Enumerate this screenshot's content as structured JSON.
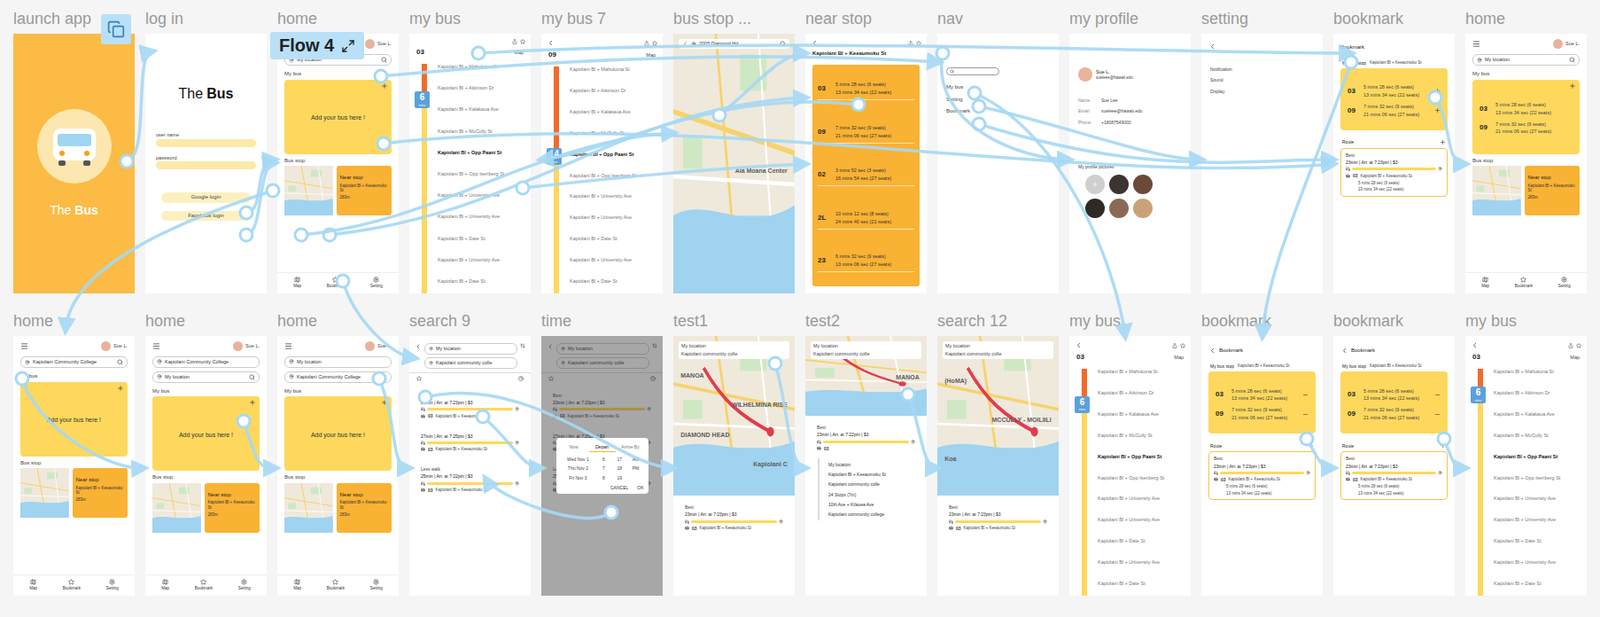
{
  "canvas": {
    "flow": "Flow 4"
  },
  "frames": [
    {
      "label": "launch app",
      "kind": "splash",
      "titleLight": "The",
      "titleStrong": "Bus"
    },
    {
      "label": "log in",
      "kind": "login",
      "titleLight": "The",
      "titleStrong": "Bus",
      "fields": [
        "user name",
        "password"
      ],
      "buttons": [
        "Google login",
        "Facebook login"
      ]
    },
    {
      "label": "home",
      "kind": "home",
      "user": "Sue L.",
      "searches": [
        "My location"
      ],
      "myBus": "My bus",
      "addBus": "Add your bus here !",
      "buses": [],
      "busStop": "Bus stop",
      "nearStop": {
        "title": "Near stop",
        "stop": "Kapiolani Bl + Keeaumoku St",
        "distance": "283m"
      },
      "nav": [
        "Map",
        "Bookmark",
        "Setting"
      ]
    },
    {
      "label": "my bus",
      "kind": "busline",
      "back": false,
      "route": "03",
      "mapLabel": "Map",
      "badge": "6",
      "badgeNote": "mins",
      "busLevel": 0.12,
      "stops": [
        {
          "name": "Kapiolani Bl + Mahukona St",
          "current": false
        },
        {
          "name": "Kapiolani Bl + Atkinson Dr",
          "current": false
        },
        {
          "name": "Kapiolani Bl + Kalakaua Ave",
          "current": false
        },
        {
          "name": "Kapiolani Bl + McCully St",
          "current": false
        },
        {
          "name": "Kapiolani Bl + Opp Paani St",
          "current": true
        },
        {
          "name": "Kapiolani Bl + Opp Isenberg St",
          "current": false
        },
        {
          "name": "Kapiolani Bl + University Ave",
          "current": false
        },
        {
          "name": "Kapiolani Bl + University Ave",
          "current": false
        },
        {
          "name": "Kapiolani Bl + Date St",
          "current": false
        },
        {
          "name": "Kapiolani Bl + University Ave",
          "current": false
        },
        {
          "name": "Kapiolani Bl + Date St",
          "current": false
        }
      ]
    },
    {
      "label": "my bus 7",
      "kind": "busline",
      "back": true,
      "route": "09",
      "mapLabel": "Map",
      "badge": "14",
      "badgeNote": "mins",
      "busLevel": 0.36,
      "stops": [
        {
          "name": "Kapiolani Bl + Mahukona St",
          "current": false
        },
        {
          "name": "Kapiolani Bl + Atkinson Dr",
          "current": false
        },
        {
          "name": "Kapiolani Bl + Kalakaua Ave",
          "current": false
        },
        {
          "name": "Kapiolani Bl + McCully St",
          "current": false
        },
        {
          "name": "Kapiolani Bl + Opp Paani St",
          "current": true
        },
        {
          "name": "Kapiolani Bl + Opp Isenberg St",
          "current": false
        },
        {
          "name": "Kapiolani Bl + University Ave",
          "current": false
        },
        {
          "name": "Kapiolani Bl + University Ave",
          "current": false
        },
        {
          "name": "Kapiolani Bl + Date St",
          "current": false
        },
        {
          "name": "Kapiolani Bl + University Ave",
          "current": false
        },
        {
          "name": "Kapiolani Bl + Date St",
          "current": false
        }
      ]
    },
    {
      "label": "bus stop ...",
      "kind": "map",
      "search": "2005 Diamond Hd",
      "places": [
        "Ala Moana Center"
      ]
    },
    {
      "label": "near stop",
      "kind": "stoptimes",
      "title": "Kapiolani Bl + Keeaumoku St",
      "routes": [
        {
          "route": "03",
          "times": [
            "5 mins 28 sec (6 seats)",
            "13 mins 34 sec (22 seats)"
          ]
        },
        {
          "route": "09",
          "times": [
            "7 mins 32 sec (9 seats)",
            "21 mins 06 sec (27 seats)"
          ]
        },
        {
          "route": "02",
          "times": [
            "3 mins 52 sec (3 seats)",
            "16 mins 54 sec (27 seats)"
          ]
        },
        {
          "route": "2L",
          "times": [
            "10 mins 12 sec (8 seats)",
            "24 mins 40 sec (21 seats)"
          ]
        },
        {
          "route": "23",
          "times": [
            "6 mins 32 sec (9 seats)",
            "13 mins 06 sec (27 seats)"
          ]
        }
      ]
    },
    {
      "label": "nav",
      "kind": "nav",
      "items": [
        "My bus",
        "Setting",
        "Bookmark"
      ]
    },
    {
      "label": "my profile",
      "kind": "profile",
      "name": "Sue L.",
      "email": "sueleee@hawaii.edu",
      "fields": [
        {
          "key": "Name",
          "value": "Sue Lee"
        },
        {
          "key": "Email",
          "value": "sueleee@hawaii.edu"
        },
        {
          "key": "Phone",
          "value": "+18087549000"
        }
      ],
      "picturesTitle": "My profile pictures",
      "pictures": [
        {
          "color": "#3b3430"
        },
        {
          "color": "#6b4a3a"
        },
        {
          "color": "#2f2a28"
        },
        {
          "color": "#8a6a55"
        },
        {
          "color": "#c9a27a"
        }
      ]
    },
    {
      "label": "setting",
      "kind": "settings",
      "items": [
        "Notification",
        "Sound",
        "Display"
      ]
    },
    {
      "label": "bookmark",
      "kind": "bookmark",
      "back": false,
      "title": "Bookmark",
      "stopTitle": "My bus stop",
      "stopName": "Kapiolani Bl + Keeaumoku St",
      "removable": false,
      "routes": [
        {
          "route": "03",
          "times": [
            "5 mins 28 sec (6 seats)",
            "13 mins 34 sec (22 seats)"
          ]
        },
        {
          "route": "09",
          "times": [
            "7 mins 32 sec (9 seats)",
            "21 mins 06 sec (27 seats)"
          ]
        }
      ],
      "routeTitle": "Route",
      "trip": {
        "label": "Best",
        "summary": "23min | Arr. at 7:23pm | $3",
        "line": "03",
        "stop": "Kapiolani Bl + Keeaumoku St",
        "times": [
          "5 mins 28 sec (6 seats)",
          "13 mins 34 sec (22 seats)"
        ]
      }
    },
    {
      "label": "home",
      "kind": "home",
      "user": "Sue L.",
      "searches": [
        "My location"
      ],
      "myBus": "My bus",
      "buses": [
        {
          "route": "03",
          "times": [
            "5 mins 28 sec (6 seats)",
            "13 mins 34 sec (22 seats)"
          ]
        },
        {
          "route": "09",
          "times": [
            "7 mins 32 sec (9 seats)",
            "21 mins 06 sec (27 seats)"
          ]
        }
      ],
      "busStop": "Bus stop",
      "nearStop": {
        "title": "Near stop",
        "stop": "Kapiolani Bl + Keeaumoku St",
        "distance": "283m"
      },
      "nav": [
        "Map",
        "Bookmark",
        "Setting"
      ]
    },
    {
      "label": "home",
      "kind": "home",
      "user": "Sue L.",
      "searches": [
        "Kapiolani Community College"
      ],
      "myBus": "My bus",
      "addBus": "Add your bus here !",
      "buses": [],
      "busStop": "Bus stop",
      "nearStop": {
        "title": "Near stop",
        "stop": "Kapiolani Bl + Keeaumoku St",
        "distance": "283m"
      },
      "nav": [
        "Map",
        "Bookmark",
        "Setting"
      ]
    },
    {
      "label": "home",
      "kind": "home",
      "user": "Sue L.",
      "searches": [
        "Kapiolani Community College",
        "My location"
      ],
      "myBus": "My bus",
      "addBus": "Add your bus here !",
      "buses": [],
      "busStop": "Bus stop",
      "nearStop": {
        "title": "Near stop",
        "stop": "Kapiolani Bl + Keeaumoku St",
        "distance": "283m"
      },
      "nav": [
        "Map",
        "Bookmark",
        "Setting"
      ]
    },
    {
      "label": "home",
      "kind": "home",
      "user": "Sue L.",
      "searches": [
        "My location",
        "Kapiolani Community College"
      ],
      "myBus": "My bus",
      "addBus": "Add your bus here !",
      "buses": [],
      "busStop": "Bus stop",
      "nearStop": {
        "title": "Near stop",
        "stop": "Kapiolani Bl + Keeaumoku St",
        "distance": "283m"
      },
      "nav": [
        "Map",
        "Bookmark",
        "Setting"
      ]
    },
    {
      "label": "search 9",
      "kind": "search",
      "from": "My location",
      "to": "Kapiolani community colle",
      "results": [
        {
          "label": "Best",
          "summary": "23min | Arr. at 7:23pm | $3",
          "line": "03",
          "stop": "Kapiolani Bl + Keeaumoku St"
        },
        {
          "summary": "27min | Arr. at 7:25pm | $3",
          "line": "03",
          "stop": "Kapiolani Bl + Keeaumoku St"
        },
        {
          "label": "Less walk",
          "summary": "25min | Arr. at 7:22pm | $3",
          "line": "03",
          "stop": "Kapiolani Bl + Keeaumoku St"
        }
      ]
    },
    {
      "label": "time",
      "kind": "time",
      "from": "My location",
      "to": "Kapiolani community colle",
      "results": [
        {
          "label": "Best",
          "summary": "23min | Arr. at 7:23pm | $3",
          "line": "03",
          "stop": "Kapiolani Bl + Keeaumoku St"
        },
        {
          "summary": "27min | Arr. at 7:25pm | $3",
          "line": "03",
          "stop": "Kapiolani Bl + Keeaumoku St"
        },
        {
          "label": "Less walk",
          "summary": "25min | Arr. at 7:22pm | $3",
          "line": "03",
          "stop": "Kapiolani Bl + Keeaumoku St"
        }
      ],
      "dialog": {
        "modes": [
          {
            "label": "Now",
            "selected": false
          },
          {
            "label": "Depart",
            "selected": true
          },
          {
            "label": "Arrive By",
            "selected": false
          }
        ],
        "days": [
          "Wed Nov 1",
          "Thu Nov 2",
          "Fri Nov 3"
        ],
        "hours": [
          "6",
          "7",
          "8"
        ],
        "minutes": [
          "17",
          "18",
          "19"
        ],
        "periods": [
          "AM",
          "PM"
        ],
        "actions": [
          "CANCEL",
          "OK"
        ]
      }
    },
    {
      "label": "test1",
      "kind": "routemap",
      "from": "My location",
      "to": "Kapiolani community colle",
      "places": [
        "MANOA",
        "WILHELMINA RISE",
        "DIAMOND HEAD",
        "Kapiolani C"
      ],
      "result": {
        "label": "Best",
        "summary": "23min | Arr. at 7:23pm | $3",
        "line": "03",
        "stop": "Kapiolani Bl + Keeaumoku St"
      }
    },
    {
      "label": "test2",
      "kind": "routedetail",
      "from": "My location",
      "to": "Kapiolani community colle",
      "places": [
        "MANOA"
      ],
      "result": {
        "label": "Best",
        "summary": "23min | Arr. at 7:22pm | $3",
        "line": "03"
      },
      "steps": [
        "My location",
        "Kapiolani Bl + Keeaumoku St",
        "Kapiolani community colle",
        "24 Stops (7m)",
        "10th Ave + Kilauea Ave",
        "Kapiolani community college"
      ]
    },
    {
      "label": "search 12",
      "kind": "routemap",
      "from": "My location",
      "to": "Kapiolani community colle",
      "places": [
        "(HoMA)",
        "MCCULLY - MOILIILI",
        "Koa"
      ],
      "result": {
        "label": "Best",
        "summary": "23min | Arr. at 7:23pm | $3",
        "line": "03",
        "stop": "Kapiolani Bl + Keeaumoku St"
      }
    },
    {
      "label": "my bus",
      "kind": "busline",
      "back": true,
      "route": "03",
      "mapLabel": "Map",
      "badge": "6",
      "badgeNote": "mins",
      "busLevel": 0.12,
      "stops": [
        {
          "name": "Kapiolani Bl + Mahukona St",
          "current": false
        },
        {
          "name": "Kapiolani Bl + Atkinson Dr",
          "current": false
        },
        {
          "name": "Kapiolani Bl + Kalakaua Ave",
          "current": false
        },
        {
          "name": "Kapiolani Bl + McCully St",
          "current": false
        },
        {
          "name": "Kapiolani Bl + Opp Paani St",
          "current": true
        },
        {
          "name": "Kapiolani Bl + Opp Isenberg St",
          "current": false
        },
        {
          "name": "Kapiolani Bl + University Ave",
          "current": false
        },
        {
          "name": "Kapiolani Bl + University Ave",
          "current": false
        },
        {
          "name": "Kapiolani Bl + Date St",
          "current": false
        },
        {
          "name": "Kapiolani Bl + University Ave",
          "current": false
        },
        {
          "name": "Kapiolani Bl + Date St",
          "current": false
        }
      ]
    },
    {
      "label": "bookmark",
      "kind": "bookmark",
      "back": true,
      "title": "Bookmark",
      "stopTitle": "My bus stop",
      "stopName": "Kapiolani Bl + Keeaumoku St",
      "removable": true,
      "routes": [
        {
          "route": "03",
          "times": [
            "5 mins 28 sec (6 seats)",
            "13 mins 34 sec (22 seats)"
          ]
        },
        {
          "route": "09",
          "times": [
            "7 mins 32 sec (9 seats)",
            "21 mins 06 sec (27 seats)"
          ]
        }
      ],
      "routeTitle": "Route",
      "trip": {
        "label": "Best",
        "summary": "23min | Arr. at 7:23pm | $3",
        "line": "03",
        "stop": "Kapiolani Bl + Keeaumoku St",
        "times": [
          "5 mins 28 sec (6 seats)",
          "13 mins 34 sec (22 seats)"
        ]
      }
    },
    {
      "label": "bookmark",
      "kind": "bookmark",
      "back": true,
      "title": "Bookmark",
      "stopTitle": "My bus stop",
      "stopName": "Kapiolani Bl + Keeaumoku St",
      "removable": true,
      "routes": [
        {
          "route": "03",
          "times": [
            "5 mins 28 sec (6 seats)",
            "13 mins 34 sec (22 seats)"
          ]
        },
        {
          "route": "09",
          "times": [
            "7 mins 32 sec (9 seats)",
            "21 mins 06 sec (27 seats)"
          ]
        }
      ],
      "routeTitle": "Route",
      "trip": {
        "label": "Best",
        "summary": "23min | Arr. at 7:23pm | $3",
        "line": "03",
        "stop": "Kapiolani Bl + Keeaumoku St",
        "times": [
          "5 mins 28 sec (6 seats)",
          "13 mins 34 sec (22 seats)"
        ]
      }
    },
    {
      "label": "my bus",
      "kind": "busline",
      "back": true,
      "route": "03",
      "mapLabel": "Map",
      "badge": "6",
      "badgeNote": "mins",
      "busLevel": 0.08,
      "stops": [
        {
          "name": "Kapiolani Bl + Mahukona St",
          "current": false
        },
        {
          "name": "Kapiolani Bl + Atkinson Dr",
          "current": false
        },
        {
          "name": "Kapiolani Bl + Kalakaua Ave",
          "current": false
        },
        {
          "name": "Kapiolani Bl + McCully St",
          "current": false
        },
        {
          "name": "Kapiolani Bl + Opp Paani St",
          "current": true
        },
        {
          "name": "Kapiolani Bl + Opp Isenberg St",
          "current": false
        },
        {
          "name": "Kapiolani Bl + University Ave",
          "current": false
        },
        {
          "name": "Kapiolani Bl + University Ave",
          "current": false
        },
        {
          "name": "Kapiolani Bl + Date St",
          "current": false
        },
        {
          "name": "Kapiolani Bl + University Ave",
          "current": false
        },
        {
          "name": "Kapiolani Bl + Date St",
          "current": false
        }
      ]
    }
  ]
}
